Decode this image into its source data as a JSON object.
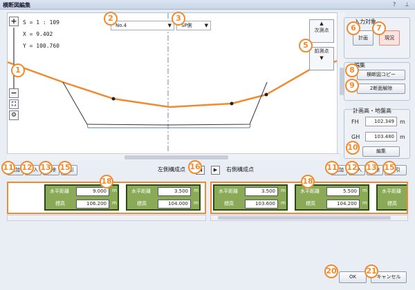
{
  "window": {
    "title": "横断図編集",
    "help_icon": "question-icon",
    "pin_icon": "pin-icon"
  },
  "viewer": {
    "scale": "S = 1 : 109",
    "x": "X = 9.402",
    "y": "Y = 100.760",
    "station": "No.4",
    "side": "SP側",
    "next": "次測点",
    "prev": "前測点"
  },
  "input_target": {
    "title": "入力対象",
    "plan": "計画",
    "current": "現況"
  },
  "edit": {
    "title": "編集",
    "copy": "横断図コピー",
    "release": "2断面解除"
  },
  "elevation": {
    "title": "計画高・地盤高",
    "fh_label": "FH",
    "fh": "102.349",
    "gh_label": "GH",
    "gh": "103.480",
    "unit": "m",
    "edit_btn": "編集"
  },
  "left_points": {
    "label": "左側構成点",
    "buttons": [
      "追加",
      "挿入",
      "削除",
      "逆引"
    ],
    "cards": [
      {
        "h_label": "水平距離",
        "h": "9.000",
        "e_label": "標高",
        "e": "106.200",
        "unit": "m"
      },
      {
        "h_label": "水平距離",
        "h": "3.500",
        "e_label": "標高",
        "e": "104.000",
        "unit": "m"
      }
    ]
  },
  "right_points": {
    "label": "右側構成点",
    "buttons": [
      "追加",
      "挿入",
      "削除",
      "逆引"
    ],
    "cards": [
      {
        "h_label": "水平距離",
        "h": "3.500",
        "e_label": "標高",
        "e": "103.600",
        "unit": "m"
      },
      {
        "h_label": "水平距離",
        "h": "5.500",
        "e_label": "標高",
        "e": "104.200",
        "unit": "m"
      },
      {
        "h_label": "水平距離",
        "h": "",
        "e_label": "標高",
        "e": "",
        "unit": "m"
      }
    ]
  },
  "footer": {
    "ok": "OK",
    "cancel": "キャンセル"
  },
  "callouts": [
    "1",
    "2",
    "3",
    "5",
    "6",
    "7",
    "8",
    "9",
    "10",
    "11",
    "12",
    "13",
    "15",
    "16",
    "18",
    "20",
    "21"
  ],
  "colors": {
    "accent": "#f08a2c",
    "card": "#8aaa57"
  }
}
